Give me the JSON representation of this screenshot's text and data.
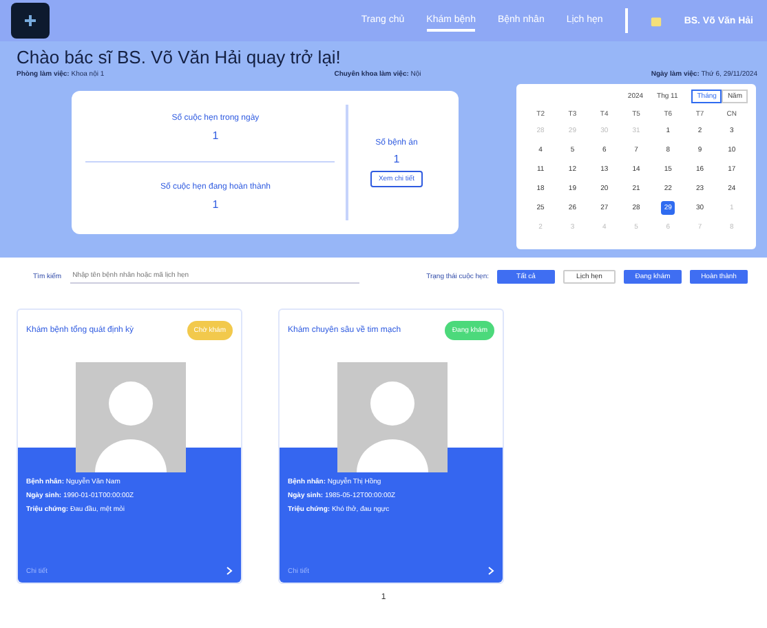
{
  "nav": {
    "links": [
      {
        "label": "Trang chủ",
        "selected": false
      },
      {
        "label": "Khám bệnh",
        "selected": true
      },
      {
        "label": "Bệnh nhân",
        "selected": false
      },
      {
        "label": "Lịch hẹn",
        "selected": false
      }
    ],
    "user": "BS. Võ Văn Hải"
  },
  "hero": {
    "greeting": "Chào bác sĩ BS. Võ Văn Hải quay trở lại!",
    "info": [
      {
        "label": "Phòng làm việc:",
        "value": "Khoa nội 1"
      },
      {
        "label": "Chuyên khoa làm việc:",
        "value": "Nội"
      },
      {
        "label": "Ngày làm việc:",
        "value": "Thứ 6, 29/11/2024"
      }
    ]
  },
  "stats": {
    "left": [
      {
        "label": "Số cuộc hẹn trong ngày",
        "value": "1"
      },
      {
        "label": "Số cuộc hẹn đang hoàn thành",
        "value": "1"
      }
    ],
    "right": {
      "label": "Số bệnh án",
      "value": "1",
      "button": "Xem chi tiết"
    }
  },
  "calendar": {
    "year": "2024",
    "month": "Thg 11",
    "modes": [
      {
        "label": "Tháng",
        "selected": true
      },
      {
        "label": "Năm",
        "selected": false
      }
    ],
    "weekdays": [
      "T2",
      "T3",
      "T4",
      "T5",
      "T6",
      "T7",
      "CN"
    ],
    "days": [
      {
        "label": "28",
        "muted": true,
        "selected": false
      },
      {
        "label": "29",
        "muted": true,
        "selected": false
      },
      {
        "label": "30",
        "muted": true,
        "selected": false
      },
      {
        "label": "31",
        "muted": true,
        "selected": false
      },
      {
        "label": "1",
        "muted": false,
        "selected": false
      },
      {
        "label": "2",
        "muted": false,
        "selected": false
      },
      {
        "label": "3",
        "muted": false,
        "selected": false
      },
      {
        "label": "4",
        "muted": false,
        "selected": false
      },
      {
        "label": "5",
        "muted": false,
        "selected": false
      },
      {
        "label": "6",
        "muted": false,
        "selected": false
      },
      {
        "label": "7",
        "muted": false,
        "selected": false
      },
      {
        "label": "8",
        "muted": false,
        "selected": false
      },
      {
        "label": "9",
        "muted": false,
        "selected": false
      },
      {
        "label": "10",
        "muted": false,
        "selected": false
      },
      {
        "label": "11",
        "muted": false,
        "selected": false
      },
      {
        "label": "12",
        "muted": false,
        "selected": false
      },
      {
        "label": "13",
        "muted": false,
        "selected": false
      },
      {
        "label": "14",
        "muted": false,
        "selected": false
      },
      {
        "label": "15",
        "muted": false,
        "selected": false
      },
      {
        "label": "16",
        "muted": false,
        "selected": false
      },
      {
        "label": "17",
        "muted": false,
        "selected": false
      },
      {
        "label": "18",
        "muted": false,
        "selected": false
      },
      {
        "label": "19",
        "muted": false,
        "selected": false
      },
      {
        "label": "20",
        "muted": false,
        "selected": false
      },
      {
        "label": "21",
        "muted": false,
        "selected": false
      },
      {
        "label": "22",
        "muted": false,
        "selected": false
      },
      {
        "label": "23",
        "muted": false,
        "selected": false
      },
      {
        "label": "24",
        "muted": false,
        "selected": false
      },
      {
        "label": "25",
        "muted": false,
        "selected": false
      },
      {
        "label": "26",
        "muted": false,
        "selected": false
      },
      {
        "label": "27",
        "muted": false,
        "selected": false
      },
      {
        "label": "28",
        "muted": false,
        "selected": false
      },
      {
        "label": "29",
        "muted": false,
        "selected": true
      },
      {
        "label": "30",
        "muted": false,
        "selected": false
      },
      {
        "label": "1",
        "muted": true,
        "selected": false
      },
      {
        "label": "2",
        "muted": true,
        "selected": false
      },
      {
        "label": "3",
        "muted": true,
        "selected": false
      },
      {
        "label": "4",
        "muted": true,
        "selected": false
      },
      {
        "label": "5",
        "muted": true,
        "selected": false
      },
      {
        "label": "6",
        "muted": true,
        "selected": false
      },
      {
        "label": "7",
        "muted": true,
        "selected": false
      },
      {
        "label": "8",
        "muted": true,
        "selected": false
      }
    ]
  },
  "filter": {
    "label": "Tìm kiếm",
    "placeholder": "Nhập tên bệnh nhân hoặc mã lịch hẹn",
    "status_label": "Trạng thái cuộc hẹn:",
    "controls": [
      {
        "kind": "button",
        "label": "Tất cả"
      },
      {
        "kind": "select",
        "label": "Lịch hẹn"
      },
      {
        "kind": "button",
        "label": "Đang khám"
      },
      {
        "kind": "button",
        "label": "Hoàn thành"
      }
    ]
  },
  "cards": [
    {
      "title": "Khám bệnh tổng quát định kỳ",
      "status": "Chờ khám",
      "color": "#f2c94c",
      "fields": [
        {
          "label": "Bệnh nhân:",
          "value": "Nguyễn Văn Nam"
        },
        {
          "label": "Ngày sinh:",
          "value": "1990-01-01T00:00:00Z"
        },
        {
          "label": "Triệu chứng:",
          "value": "Đau đầu, mệt mỏi"
        }
      ],
      "footer": "Chi tiết"
    },
    {
      "title": "Khám chuyên sâu về tim mạch",
      "status": "Đang khám",
      "color": "#4cd97b",
      "fields": [
        {
          "label": "Bệnh nhân:",
          "value": "Nguyễn Thị Hồng"
        },
        {
          "label": "Ngày sinh:",
          "value": "1985-05-12T00:00:00Z"
        },
        {
          "label": "Triệu chứng:",
          "value": "Khó thở, đau ngực"
        }
      ],
      "footer": "Chi tiết"
    }
  ],
  "pagination": "1"
}
